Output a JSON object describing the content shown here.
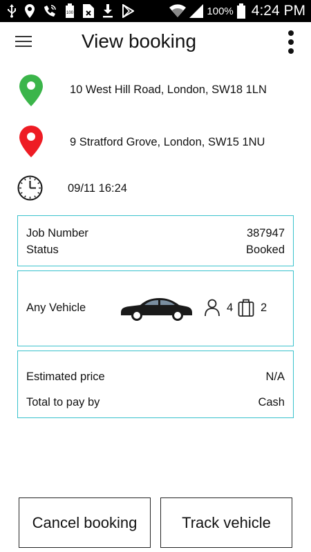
{
  "status_bar": {
    "battery_percent": "100%",
    "time": "4:24 PM",
    "left_icons": [
      "usb-icon",
      "location-icon",
      "wifi-calling-icon",
      "battery-saver-icon",
      "sim-card-icon",
      "download-icon",
      "play-store-icon"
    ],
    "right_icons": [
      "wifi-icon",
      "signal-icon",
      "battery-icon"
    ]
  },
  "header": {
    "title": "View booking",
    "menu_icon": "hamburger-menu-icon",
    "overflow_icon": "more-vertical-icon"
  },
  "booking": {
    "pickup_address": "10 West Hill Road, London, SW18 1LN",
    "pickup_icon_color": "#3bb54a",
    "dropoff_address": "9 Stratford Grove, London, SW15 1NU",
    "dropoff_icon_color": "#ee1c24",
    "datetime": "09/11 16:24"
  },
  "job_card": {
    "job_number_label": "Job Number",
    "job_number_value": "387947",
    "status_label": "Status",
    "status_value": "Booked"
  },
  "vehicle_card": {
    "vehicle_label": "Any Vehicle",
    "passengers": "4",
    "luggage": "2"
  },
  "price_card": {
    "estimated_price_label": "Estimated price",
    "estimated_price_value": "N/A",
    "payment_label": "Total to pay by",
    "payment_value": "Cash"
  },
  "actions": {
    "cancel_label": "Cancel booking",
    "track_label": "Track vehicle"
  },
  "colors": {
    "card_border": "#38c1cc",
    "status_bar_bg": "#000000"
  }
}
